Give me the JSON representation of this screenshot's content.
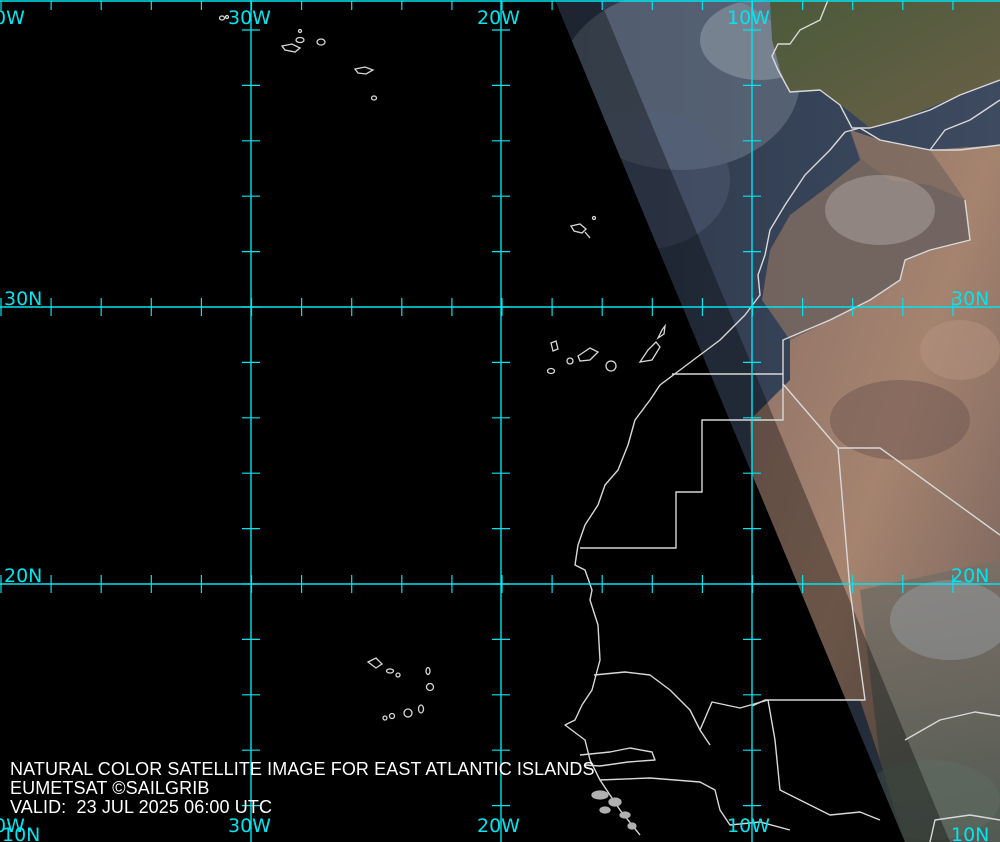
{
  "caption": {
    "title": "NATURAL COLOR SATELLITE IMAGE FOR EAST ATLANTIC ISLANDS",
    "source": "EUMETSAT ©SAILGRIB",
    "valid_label": "VALID:",
    "valid_time": "23 JUL 2025 06:00 UTC"
  },
  "grid": {
    "top_labels": [
      "0W",
      "30W",
      "20W",
      "10W"
    ],
    "bottom_labels": [
      "0W",
      "30W",
      "20W",
      "10W"
    ],
    "left_labels": [
      "30N",
      "20N",
      "10N"
    ],
    "right_labels": [
      "30N",
      "20N",
      "10N"
    ],
    "line_color": "#00e5f0"
  },
  "colors": {
    "ocean_night": "#000000",
    "coastline": "#d8d8d8",
    "desert": "#9c7a68",
    "sea_day": "#2c3a4f"
  }
}
